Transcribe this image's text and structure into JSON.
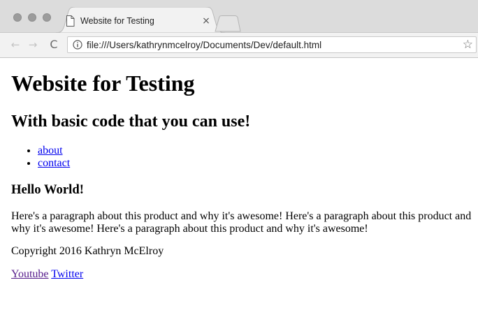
{
  "browser": {
    "tab": {
      "title": "Website for Testing",
      "close_glyph": "×",
      "icon": "page-icon"
    },
    "toolbar": {
      "back_glyph": "←",
      "forward_glyph": "→",
      "reload_glyph": "C",
      "url": "file:///Users/kathrynmcelroy/Documents/Dev/default.html",
      "info_icon": "info-icon",
      "bookmark_glyph": "☆"
    }
  },
  "page": {
    "heading": "Website for Testing",
    "subheading": "With basic code that you can use!",
    "nav_links": [
      {
        "label": "about"
      },
      {
        "label": "contact"
      }
    ],
    "section_heading": "Hello World!",
    "paragraph": "Here's a paragraph about this product and why it's awesome! Here's a paragraph about this product and why it's awesome! Here's a paragraph about this product and why it's awesome!",
    "copyright": "Copyright 2016 Kathryn McElroy",
    "social_links": [
      {
        "label": "Youtube",
        "visited": true
      },
      {
        "label": "Twitter",
        "visited": false
      }
    ]
  },
  "colors": {
    "link": "#0000ee",
    "visited_link": "#551a8b",
    "chrome_frame": "#dcdcdc",
    "toolbar": "#f2f2f2"
  }
}
